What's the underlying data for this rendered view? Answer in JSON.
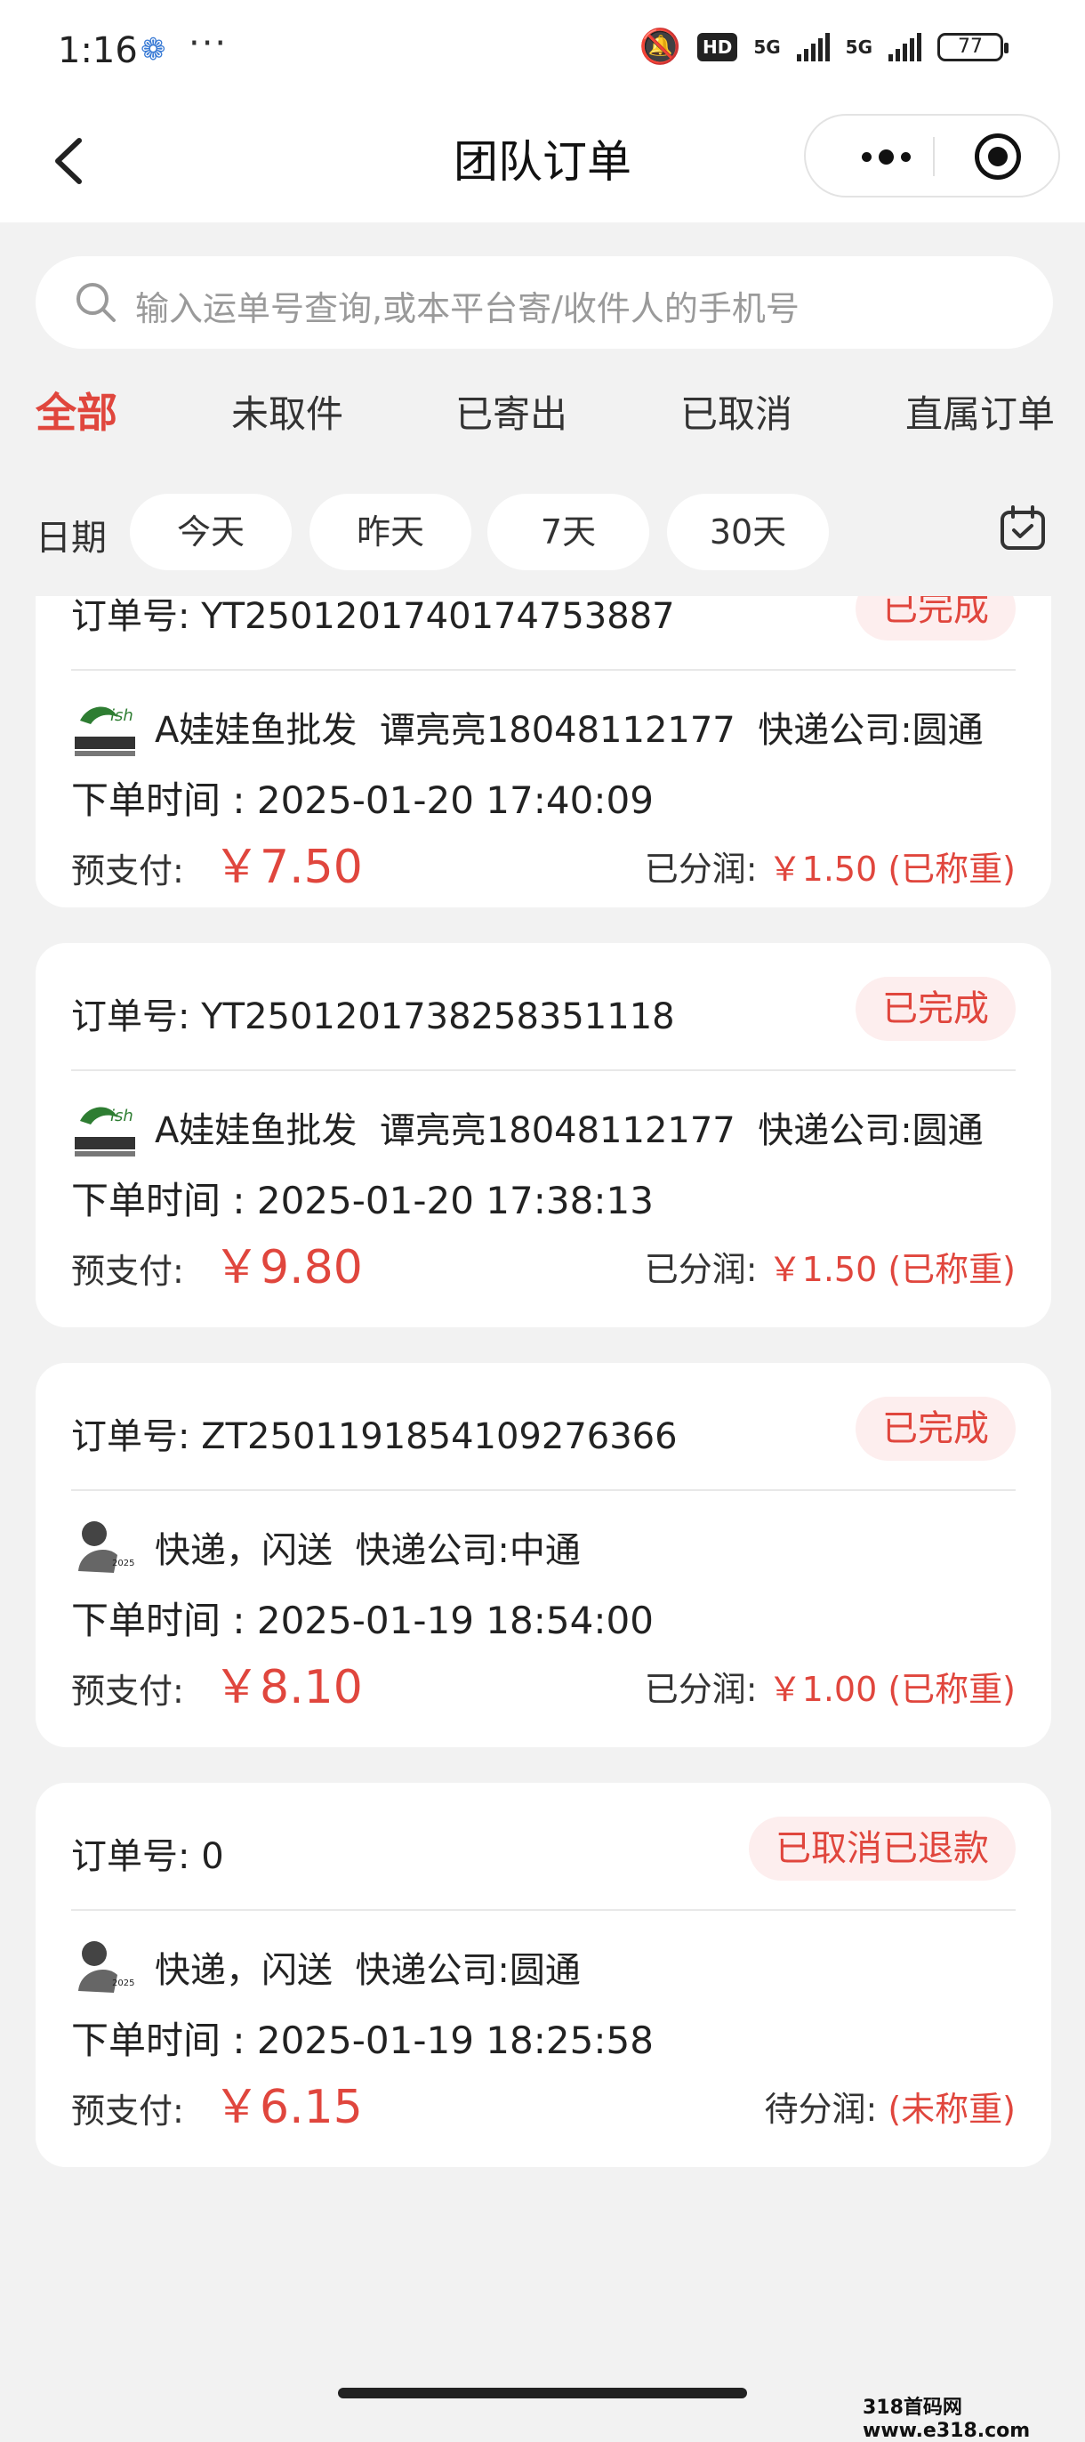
{
  "status_bar": {
    "time": "1:16",
    "dots": "···",
    "hd": "HD",
    "net1": "5G",
    "net2": "5G",
    "battery": "77"
  },
  "nav": {
    "title": "团队订单"
  },
  "search": {
    "placeholder": "输入运单号查询,或本平台寄/收件人的手机号"
  },
  "tabs": [
    {
      "label": "全部",
      "active": true
    },
    {
      "label": "未取件"
    },
    {
      "label": "已寄出"
    },
    {
      "label": "已取消"
    },
    {
      "label": "直属订单"
    }
  ],
  "date_filter": {
    "label": "日期",
    "options": [
      "今天",
      "昨天",
      "7天",
      "30天"
    ]
  },
  "orders": [
    {
      "order_label": "订单号:",
      "order_no": "YT2501201740174753887",
      "status": "已完成",
      "shop": "A娃娃鱼批发",
      "contact": "谭亮亮18048112177",
      "courier": "快递公司:圆通",
      "time": "下单时间 : 2025-01-20 17:40:09",
      "pre_label": "预支付:",
      "pre_value": "￥7.50",
      "profit_label": "已分润:",
      "profit_value": "￥1.50 (已称重)"
    },
    {
      "order_label": "订单号:",
      "order_no": "YT2501201738258351118",
      "status": "已完成",
      "shop": "A娃娃鱼批发",
      "contact": "谭亮亮18048112177",
      "courier": "快递公司:圆通",
      "time": "下单时间 : 2025-01-20 17:38:13",
      "pre_label": "预支付:",
      "pre_value": "￥9.80",
      "profit_label": "已分润:",
      "profit_value": "￥1.50 (已称重)"
    },
    {
      "order_label": "订单号:",
      "order_no": "ZT2501191854109276366",
      "status": "已完成",
      "shop": "快递，闪送",
      "contact": "",
      "courier": "快递公司:中通",
      "time": "下单时间 : 2025-01-19 18:54:00",
      "pre_label": "预支付:",
      "pre_value": "￥8.10",
      "profit_label": "已分润:",
      "profit_value": "￥1.00 (已称重)"
    },
    {
      "order_label": "订单号:",
      "order_no": "0",
      "status": "已取消已退款",
      "shop": "快递，闪送",
      "contact": "",
      "courier": "快递公司:圆通",
      "time": "下单时间 : 2025-01-19 18:25:58",
      "pre_label": "预支付:",
      "pre_value": "￥6.15",
      "profit_label": "待分润:",
      "profit_value": "(未称重)"
    }
  ],
  "watermark": "318首码网 www.e318.com",
  "colors": {
    "accent": "#e0463d",
    "status_bg": "#fdeeee",
    "background": "#f2f2f2"
  }
}
